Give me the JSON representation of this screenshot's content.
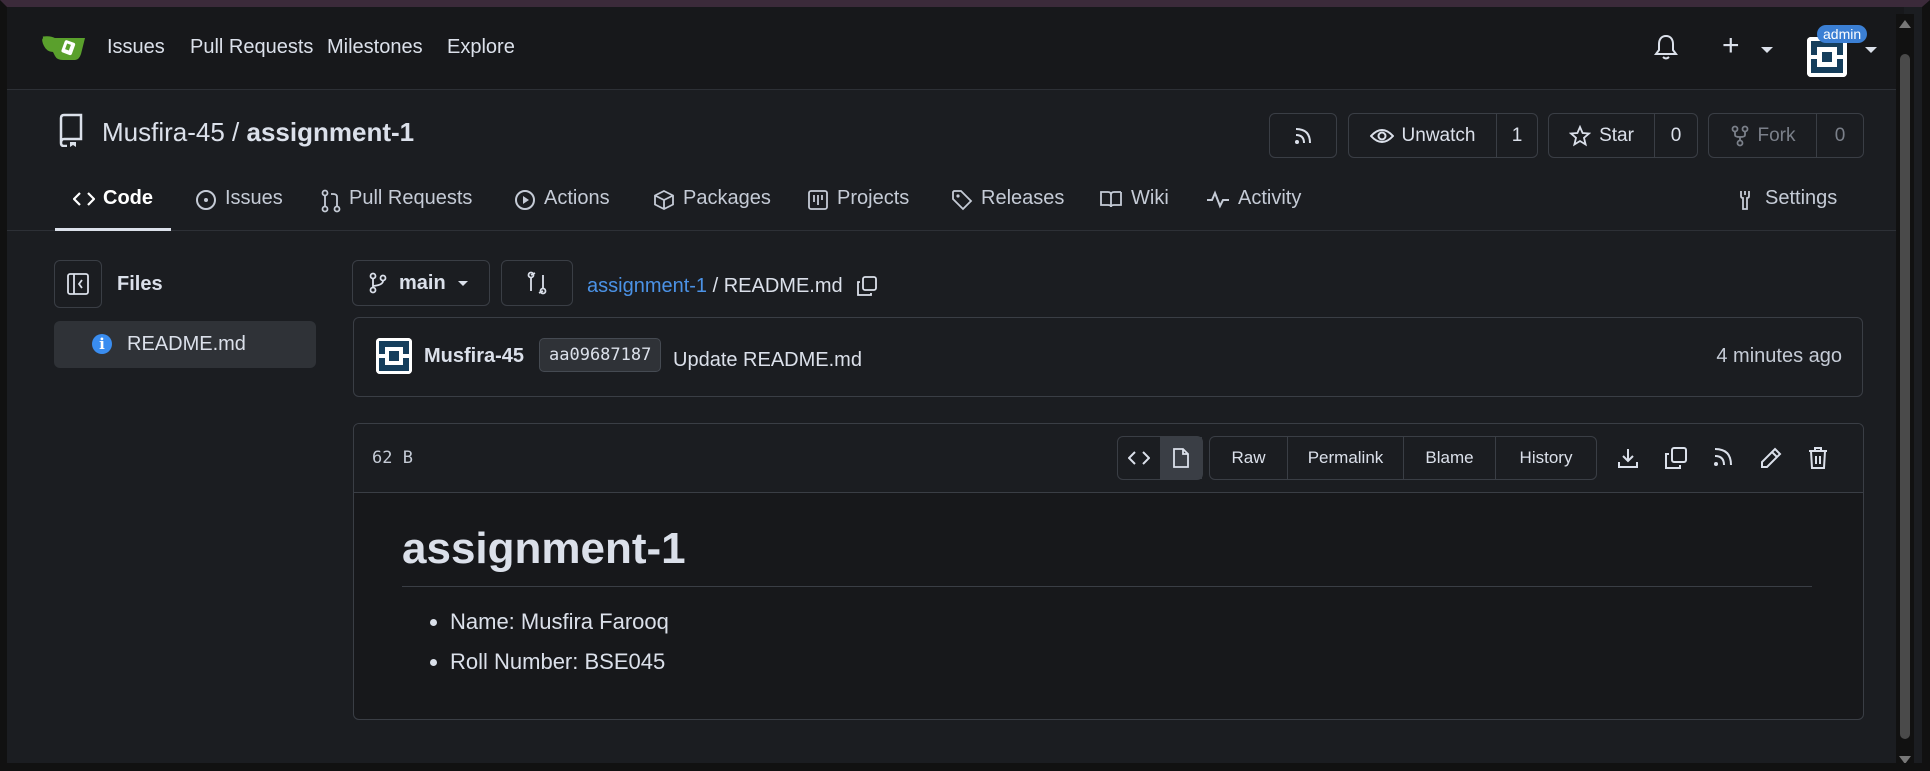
{
  "topnav": {
    "links": [
      "Issues",
      "Pull Requests",
      "Milestones",
      "Explore"
    ],
    "admin_badge": "admin"
  },
  "repo": {
    "owner": "Musfira-45",
    "separator": " / ",
    "name": "assignment-1",
    "unwatch_label": "Unwatch",
    "watch_count": "1",
    "star_label": "Star",
    "star_count": "0",
    "fork_label": "Fork",
    "fork_count": "0"
  },
  "tabs": [
    {
      "label": "Code",
      "icon": "code-icon",
      "active": true
    },
    {
      "label": "Issues",
      "icon": "issue-icon"
    },
    {
      "label": "Pull Requests",
      "icon": "pull-request-icon"
    },
    {
      "label": "Actions",
      "icon": "play-icon"
    },
    {
      "label": "Packages",
      "icon": "package-icon"
    },
    {
      "label": "Projects",
      "icon": "project-icon"
    },
    {
      "label": "Releases",
      "icon": "tag-icon"
    },
    {
      "label": "Wiki",
      "icon": "book-icon"
    },
    {
      "label": "Activity",
      "icon": "pulse-icon"
    },
    {
      "label": "Settings",
      "icon": "tools-icon"
    }
  ],
  "sidebar": {
    "title": "Files",
    "files": [
      {
        "label": "README.md",
        "icon": "info-icon"
      }
    ]
  },
  "branch": {
    "name": "main"
  },
  "breadcrumb": {
    "repo_link": "assignment-1",
    "separator": " / ",
    "file": "README.md"
  },
  "commit": {
    "author": "Musfira-45",
    "sha": "aa09687187",
    "message": "Update README.md",
    "time": "4 minutes ago"
  },
  "file": {
    "size": "62 B",
    "actions": [
      "Raw",
      "Permalink",
      "Blame",
      "History"
    ]
  },
  "readme": {
    "heading": "assignment-1",
    "items": [
      "Name: Musfira Farooq",
      "Roll Number: BSE045"
    ]
  },
  "colors": {
    "link": "#4b92e6",
    "badge": "#3b7fd4",
    "logo": "#5aa02c"
  }
}
